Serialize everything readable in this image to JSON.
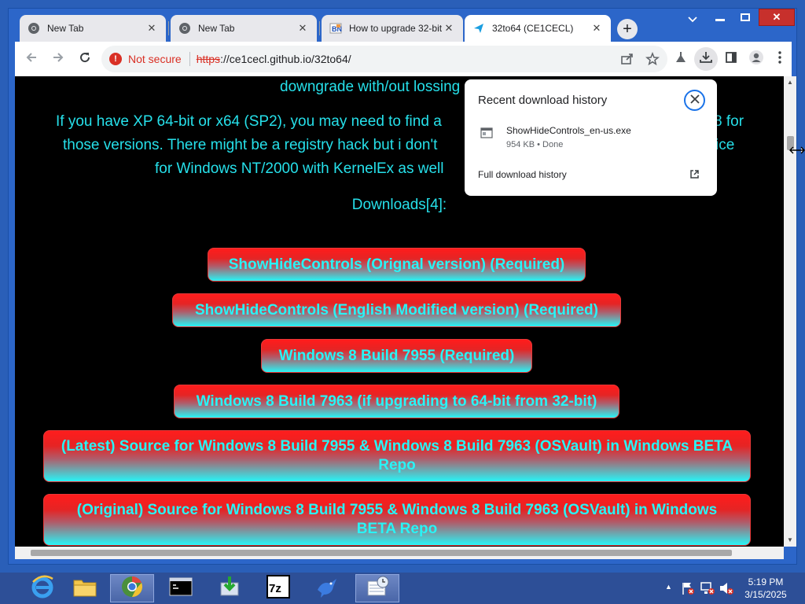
{
  "tabs": [
    {
      "title": "New Tab",
      "icon": "chrome-icon"
    },
    {
      "title": "New Tab",
      "icon": "chrome-icon"
    },
    {
      "title": "How to upgrade 32-bit",
      "icon": "site-favicon-icon"
    },
    {
      "title": "32to64 (CE1CECL)",
      "icon": "paper-plane-icon"
    }
  ],
  "toolbar": {
    "security_label": "Not secure",
    "url_scheme": "https",
    "url_rest": "://ce1cecl.github.io/32to64/"
  },
  "page": {
    "partial_line": "downgrade with/out lossing",
    "paragraph_lines": [
      "If you have XP 64-bit or x64 (SP2), you may need to find a",
      "those versions. There might be a registry hack but i don't",
      "for Windows NT/2000 with KernelEx as well"
    ],
    "paragraph_right_fragments": [
      "8 for",
      "ice"
    ],
    "downloads_heading": "Downloads[4]:",
    "buttons": [
      "ShowHideControls (Orignal version) (Required)",
      "ShowHideControls (English Modified version) (Required)",
      "Windows 8 Build 7955 (Required)",
      "Windows 8 Build 7963 (if upgrading to 64-bit from 32-bit)",
      "(Latest) Source for Windows 8 Build 7955 & Windows 8 Build 7963 (OSVault) in Windows BETA Repo",
      "(Original) Source for Windows 8 Build 7955 & Windows 8 Build 7963 (OSVault) in Windows BETA Repo"
    ]
  },
  "download_bubble": {
    "title": "Recent download history",
    "file_name": "ShowHideControls_en-us.exe",
    "file_status": "954 KB • Done",
    "full_history_label": "Full download history"
  },
  "taskbar": {
    "time": "5:19 PM",
    "date": "3/15/2025",
    "apps": [
      "internet-explorer-icon",
      "file-explorer-icon",
      "chrome-icon",
      "command-prompt-icon",
      "download-installer-icon",
      "7zip-icon",
      "bird-app-icon",
      "task-scheduler-icon"
    ]
  },
  "colors": {
    "page_text": "#26e0ea",
    "button_text": "#28f4f6",
    "button_top": "#ff1c1c",
    "button_bottom": "#28f4f6",
    "not_secure": "#d93025",
    "taskbar": "#2d4f97"
  }
}
